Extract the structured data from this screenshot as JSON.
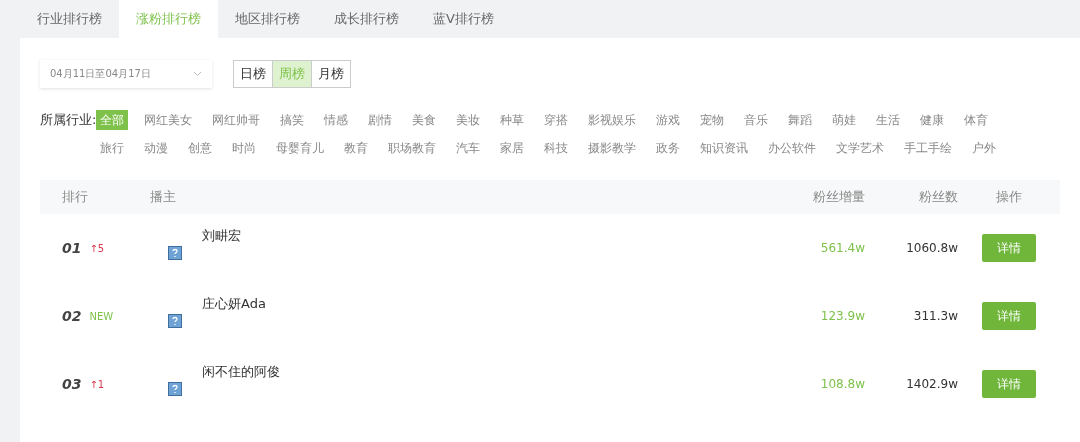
{
  "tabs": [
    {
      "label": "行业排行榜",
      "selected": false
    },
    {
      "label": "涨粉排行榜",
      "selected": true
    },
    {
      "label": "地区排行榜",
      "selected": false
    },
    {
      "label": "成长排行榜",
      "selected": false
    },
    {
      "label": "蓝V排行榜",
      "selected": false
    }
  ],
  "date_range": {
    "value": "04月11日至04月17日"
  },
  "periods": [
    {
      "label": "日榜",
      "selected": false
    },
    {
      "label": "周榜",
      "selected": true
    },
    {
      "label": "月榜",
      "selected": false
    }
  ],
  "industry": {
    "label": "所属行业:",
    "items": [
      {
        "label": "全部",
        "selected": true
      },
      {
        "label": "网红美女",
        "selected": false
      },
      {
        "label": "网红帅哥",
        "selected": false
      },
      {
        "label": "搞笑",
        "selected": false
      },
      {
        "label": "情感",
        "selected": false
      },
      {
        "label": "剧情",
        "selected": false
      },
      {
        "label": "美食",
        "selected": false
      },
      {
        "label": "美妆",
        "selected": false
      },
      {
        "label": "种草",
        "selected": false
      },
      {
        "label": "穿搭",
        "selected": false
      },
      {
        "label": "影视娱乐",
        "selected": false
      },
      {
        "label": "游戏",
        "selected": false
      },
      {
        "label": "宠物",
        "selected": false
      },
      {
        "label": "音乐",
        "selected": false
      },
      {
        "label": "舞蹈",
        "selected": false
      },
      {
        "label": "萌娃",
        "selected": false
      },
      {
        "label": "生活",
        "selected": false
      },
      {
        "label": "健康",
        "selected": false
      },
      {
        "label": "体育",
        "selected": false
      },
      {
        "label": "旅行",
        "selected": false
      },
      {
        "label": "动漫",
        "selected": false
      },
      {
        "label": "创意",
        "selected": false
      },
      {
        "label": "时尚",
        "selected": false
      },
      {
        "label": "母婴育儿",
        "selected": false
      },
      {
        "label": "教育",
        "selected": false
      },
      {
        "label": "职场教育",
        "selected": false
      },
      {
        "label": "汽车",
        "selected": false
      },
      {
        "label": "家居",
        "selected": false
      },
      {
        "label": "科技",
        "selected": false
      },
      {
        "label": "摄影教学",
        "selected": false
      },
      {
        "label": "政务",
        "selected": false
      },
      {
        "label": "知识资讯",
        "selected": false
      },
      {
        "label": "办公软件",
        "selected": false
      },
      {
        "label": "文学艺术",
        "selected": false
      },
      {
        "label": "手工手绘",
        "selected": false
      },
      {
        "label": "户外",
        "selected": false
      }
    ]
  },
  "table": {
    "columns": [
      "排行",
      "播主",
      "粉丝增量",
      "粉丝数",
      "操作"
    ],
    "rows": [
      {
        "rank": "01",
        "change": "↑5",
        "kind": "up",
        "name": "刘畊宏",
        "fan_growth": "561.4w",
        "fans": "1060.8w",
        "action": "详情"
      },
      {
        "rank": "02",
        "change": "NEW",
        "kind": "new",
        "name": "庄心妍Ada",
        "fan_growth": "123.9w",
        "fans": "311.3w",
        "action": "详情"
      },
      {
        "rank": "03",
        "change": "↑1",
        "kind": "up",
        "name": "闲不住的阿俊",
        "fan_growth": "108.8w",
        "fans": "1402.9w",
        "action": "详情"
      }
    ]
  }
}
